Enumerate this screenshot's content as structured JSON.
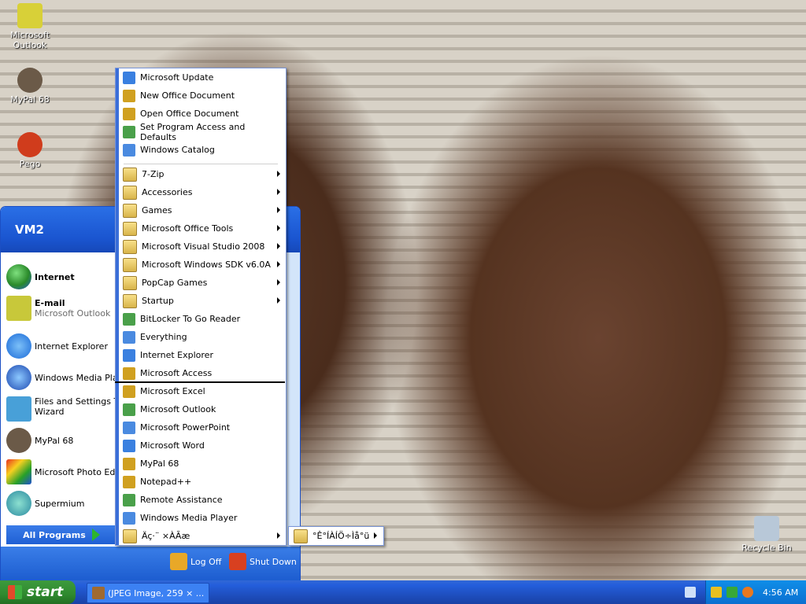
{
  "desktop": {
    "icons": [
      {
        "label": "Microsoft Outlook",
        "icon": "outlook-icon"
      },
      {
        "label": "MyPal 68",
        "icon": "mypal-icon"
      },
      {
        "label": "Pego",
        "icon": "pego-icon"
      },
      {
        "label": "Recycle Bin",
        "icon": "recycle-bin-icon"
      }
    ]
  },
  "start_menu": {
    "user": "VM2",
    "pinned": [
      {
        "title": "Internet",
        "subtitle": ""
      },
      {
        "title": "E-mail",
        "subtitle": "Microsoft Outlook"
      }
    ],
    "recent": [
      "Internet Explorer",
      "Windows Media Player",
      "Files and Settings Tra",
      "Wizard",
      "MyPal 68",
      "Microsoft Photo Edito",
      "Supermium"
    ],
    "all_programs": "All Programs",
    "log_off": "Log Off",
    "shut_down": "Shut Down"
  },
  "programs_menu": {
    "items": [
      {
        "label": "Microsoft Update",
        "submenu": false
      },
      {
        "label": "New Office Document",
        "submenu": false
      },
      {
        "label": "Open Office Document",
        "submenu": false
      },
      {
        "label": "Set Program Access and Defaults",
        "submenu": false
      },
      {
        "label": "Windows Catalog",
        "submenu": false
      },
      {
        "label": "7-Zip",
        "submenu": true
      },
      {
        "label": "Accessories",
        "submenu": true
      },
      {
        "label": "Games",
        "submenu": true
      },
      {
        "label": "Microsoft Office Tools",
        "submenu": true
      },
      {
        "label": "Microsoft Visual Studio 2008",
        "submenu": true
      },
      {
        "label": "Microsoft Windows SDK v6.0A",
        "submenu": true
      },
      {
        "label": "PopCap Games",
        "submenu": true
      },
      {
        "label": "Startup",
        "submenu": true
      },
      {
        "label": "BitLocker To Go Reader",
        "submenu": false
      },
      {
        "label": "Everything",
        "submenu": false
      },
      {
        "label": "Internet Explorer",
        "submenu": false
      },
      {
        "label": "Microsoft Access",
        "submenu": false
      },
      {
        "label": "Microsoft Excel",
        "submenu": false
      },
      {
        "label": "Microsoft Outlook",
        "submenu": false
      },
      {
        "label": "Microsoft PowerPoint",
        "submenu": false
      },
      {
        "label": "Microsoft Word",
        "submenu": false
      },
      {
        "label": "MyPal 68",
        "submenu": false
      },
      {
        "label": "Notepad++",
        "submenu": false
      },
      {
        "label": "Remote Assistance",
        "submenu": false
      },
      {
        "label": "Windows Media Player",
        "submenu": false
      },
      {
        "label": "Äç·¨ ×ÀÃæ",
        "submenu": true
      }
    ],
    "sub_menu_item": "°Ê°ÍÀÍÖ÷Ìå°ü"
  },
  "taskbar": {
    "start": "start",
    "task": "(JPEG Image, 259 × ...",
    "clock": "4:56 AM"
  }
}
